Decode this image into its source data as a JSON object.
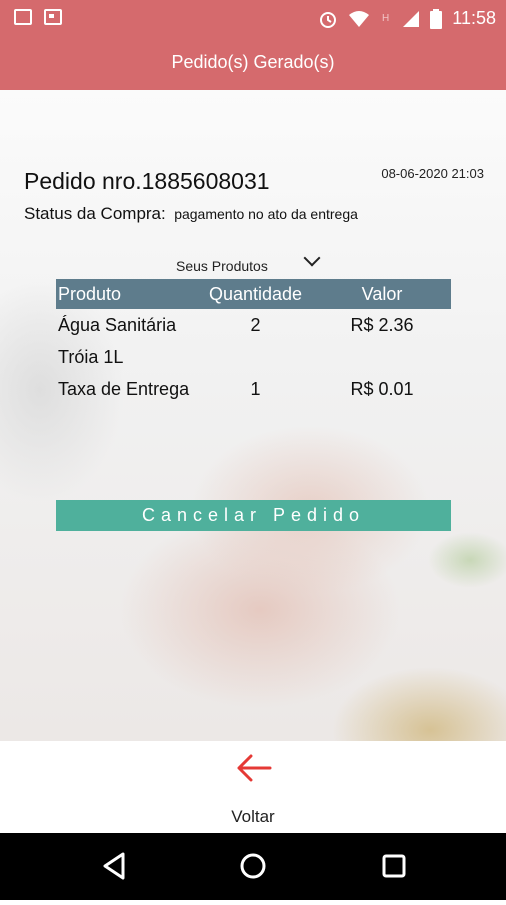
{
  "status_bar": {
    "time": "11:58"
  },
  "header": {
    "title": "Pedido(s) Gerado(s)"
  },
  "order": {
    "number": "Pedido nro.1885608031",
    "datetime": "08-06-2020 21:03",
    "status_label": "Status da Compra:",
    "status_value": "pagamento no ato da entrega"
  },
  "products": {
    "toggle_label": "Seus Produtos",
    "columns": [
      "Produto",
      "Quantidade",
      "Valor"
    ],
    "rows": [
      {
        "product": "Água Sanitária Tróia 1L",
        "quantity": "2",
        "value": "R$ 2.36"
      },
      {
        "product": "Taxa de Entrega",
        "quantity": "1",
        "value": "R$ 0.01"
      }
    ]
  },
  "actions": {
    "cancel_label": "Cancelar Pedido"
  },
  "footer": {
    "back_label": "Voltar"
  },
  "colors": {
    "accent": "#d56a6d",
    "table_header": "#5e7c8c",
    "cancel_button": "#4fb09c",
    "back_arrow": "#e53935"
  }
}
